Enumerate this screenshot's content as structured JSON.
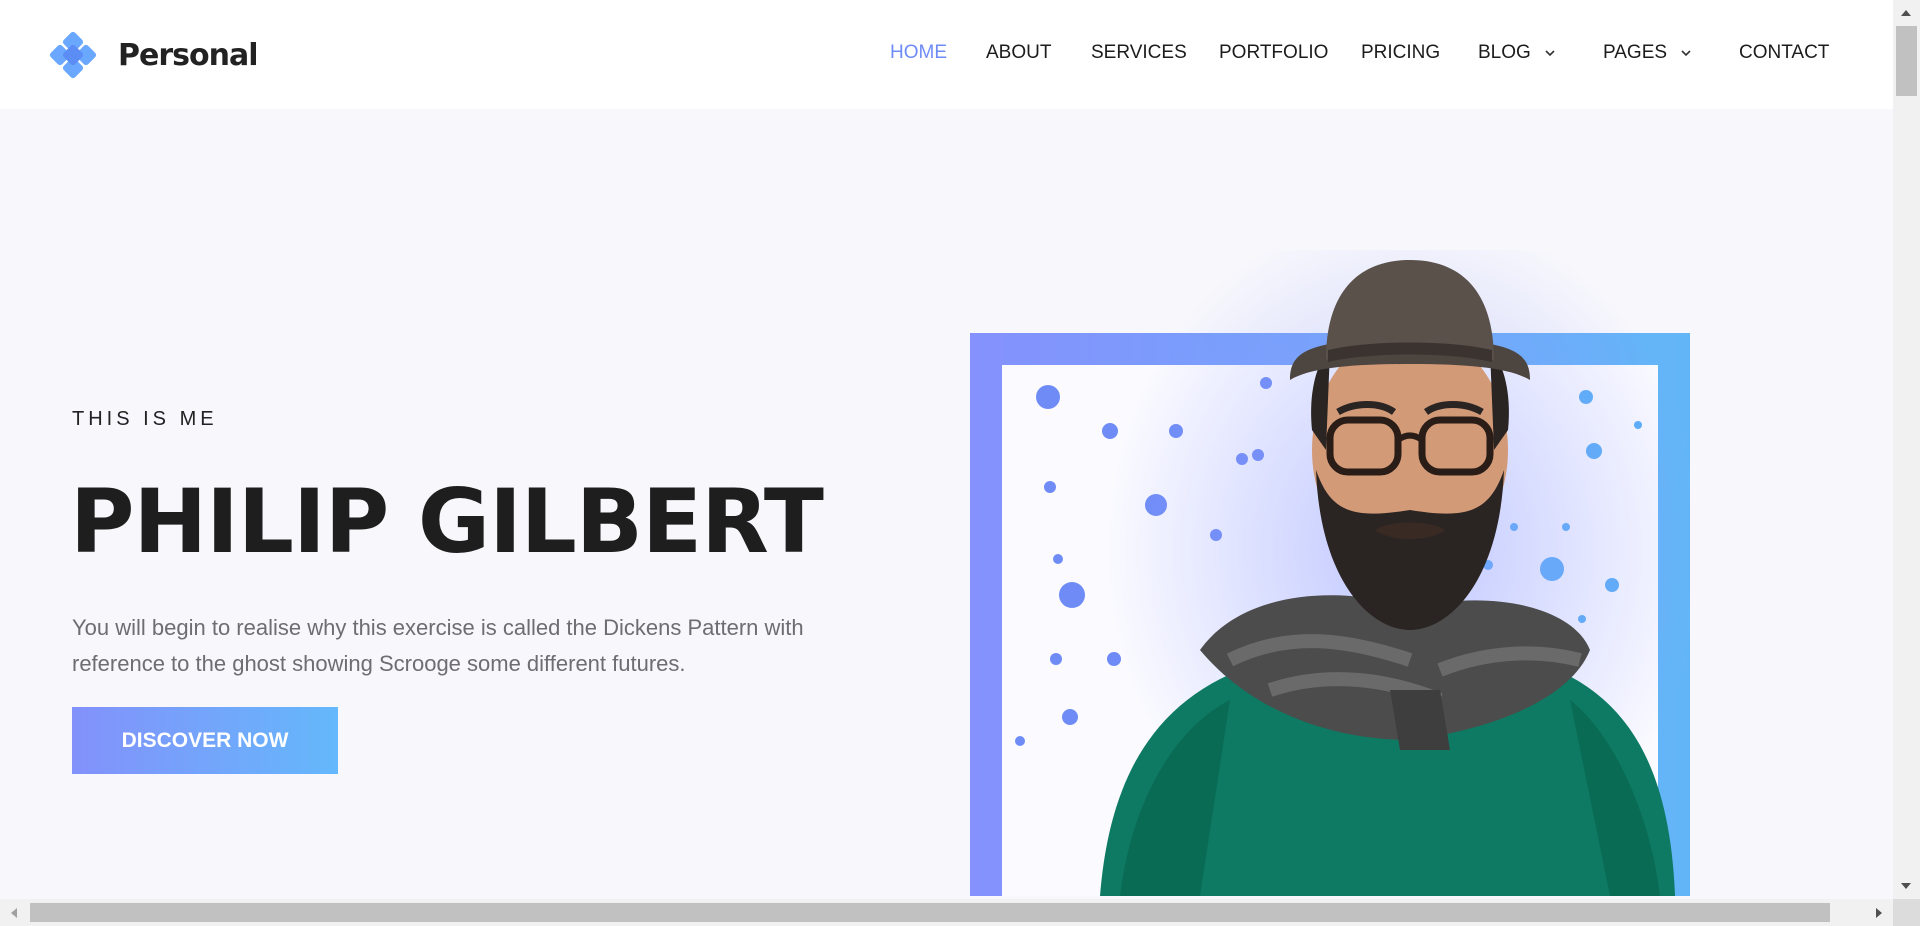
{
  "brand": {
    "name": "Personal",
    "logo_icon": "diamond-cluster-icon",
    "accent": "#6aa8ff"
  },
  "nav": {
    "items": [
      {
        "label": "HOME",
        "active": true
      },
      {
        "label": "ABOUT"
      },
      {
        "label": "SERVICES"
      },
      {
        "label": "PORTFOLIO"
      },
      {
        "label": "PRICING"
      },
      {
        "label": "BLOG",
        "dropdown": true
      },
      {
        "label": "PAGES",
        "dropdown": true
      },
      {
        "label": "CONTACT"
      }
    ],
    "active_color": "#6f8cf6"
  },
  "hero": {
    "eyebrow": "THIS IS ME",
    "title": "PHILIP GILBERT",
    "description": "You will begin to realise why this exercise is called the Dickens Pattern with reference to the ghost showing Scrooge some different futures.",
    "cta_label": "DISCOVER NOW",
    "gradient": [
      "#8391fb",
      "#64b8fb"
    ]
  },
  "portrait": {
    "icon": "person-portrait-icon",
    "frame_gradient": [
      "#8591fd",
      "#62b6f8"
    ]
  }
}
